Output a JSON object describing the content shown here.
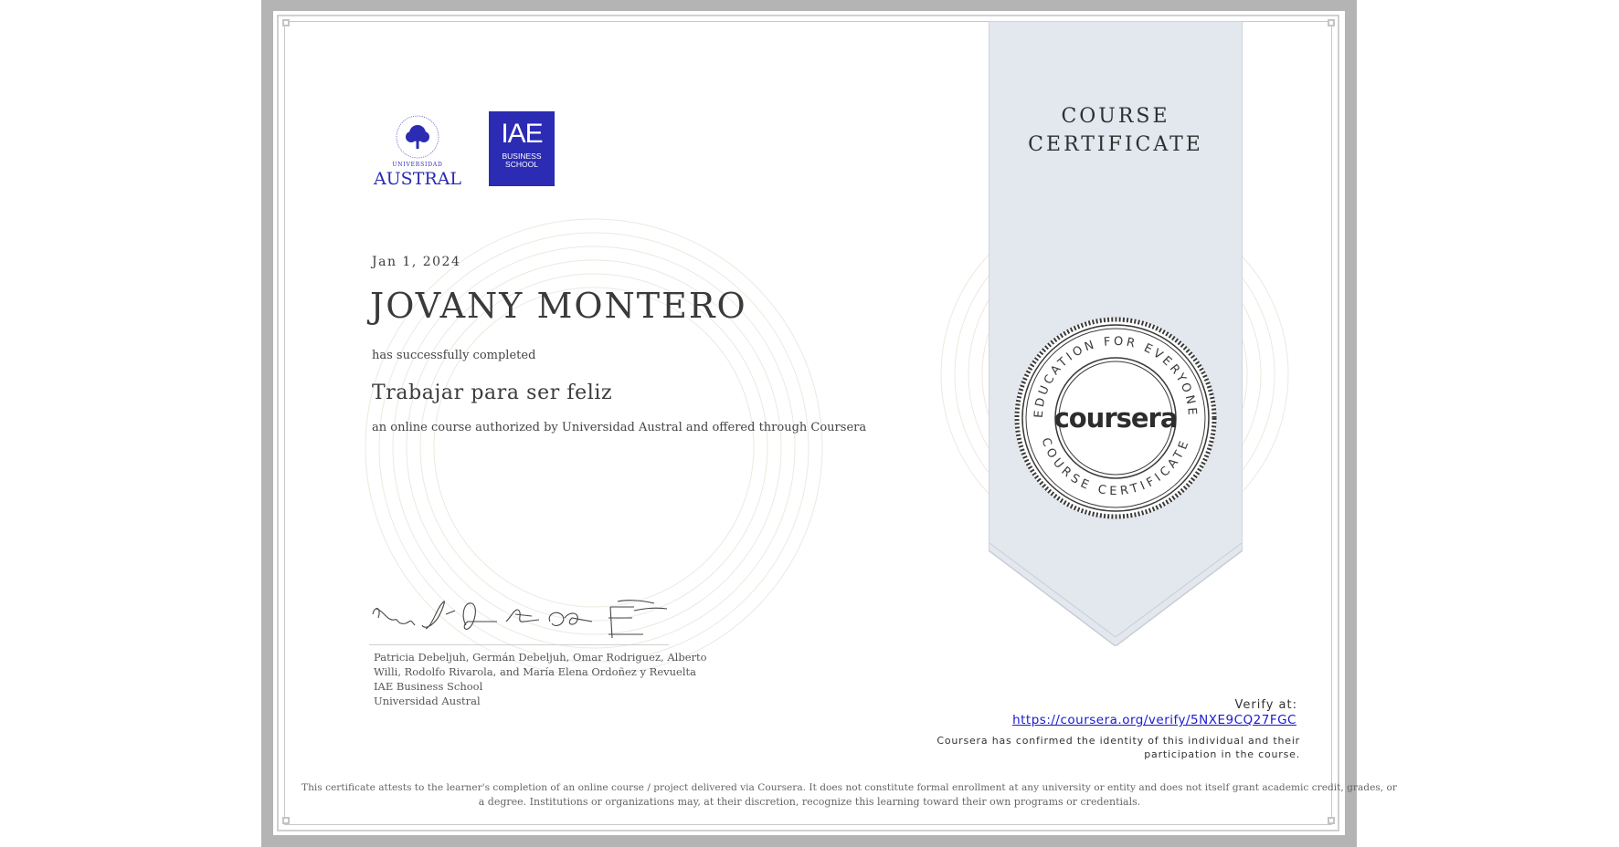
{
  "certificate": {
    "date": "Jan 1, 2024",
    "recipient_name": "JOVANY MONTERO",
    "completed_text": "has successfully completed",
    "course_name": "Trabajar para ser feliz",
    "description": "an online course authorized by Universidad Austral and offered through Coursera",
    "ribbon_title_line1": "COURSE",
    "ribbon_title_line2": "CERTIFICATE"
  },
  "logos": {
    "austral_word": "AUSTRAL",
    "austral_small": "UNIVERSIDAD",
    "iae_big": "IAE",
    "iae_line1": "BUSINESS",
    "iae_line2": "SCHOOL",
    "iae_sub": "UNIVERSIDAD AUSTRAL"
  },
  "signers": {
    "line1": "Patricia Debeljuh, Germán Debeljuh, Omar Rodriguez, Alberto",
    "line2": "Willi, Rodolfo Rivarola, and María Elena Ordoñez y Revuelta",
    "line3": "IAE Business School",
    "line4": "Universidad Austral"
  },
  "seal": {
    "top_text": "EDUCATION FOR EVERYONE",
    "bottom_text": "COURSE CERTIFICATE",
    "brand": "coursera"
  },
  "verify": {
    "label": "Verify at:",
    "url": "https://coursera.org/verify/5NXE9CQ27FGC",
    "confirmed_line1": "Coursera has confirmed the identity of this individual and their",
    "confirmed_line2": "participation in the course."
  },
  "disclaimer": {
    "line1": "This certificate attests to the learner's completion of an online course / project delivered via Coursera. It does not constitute formal enrollment at any university or entity and does not itself grant academic credit, grades, or",
    "line2": "a degree. Institutions or organizations may, at their discretion, recognize this learning toward their own programs or credentials."
  },
  "colors": {
    "frame": "#b4b4b4",
    "ribbon": "#e3e7ee",
    "iae_blue": "#2b2bb3",
    "austral_blue": "#2b2bb3",
    "link": "#1a1ad0"
  }
}
